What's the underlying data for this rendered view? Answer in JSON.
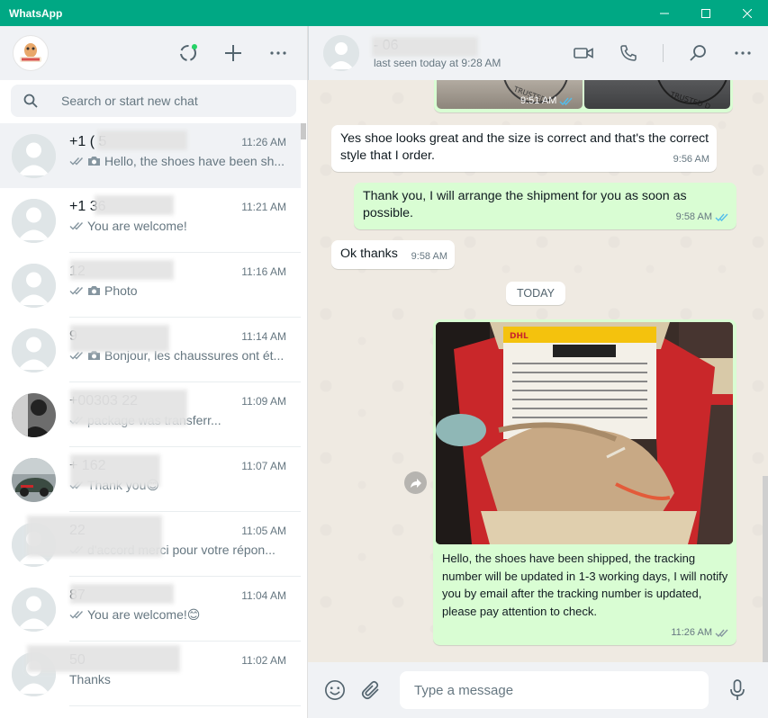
{
  "window": {
    "title": "WhatsApp"
  },
  "sidebar": {
    "search_placeholder": "Search or start new chat",
    "chats": [
      {
        "name": "+1 (           5",
        "time": "11:26 AM",
        "ticks": "read",
        "photo": true,
        "preview": "Hello, the shoes have been sh...",
        "active": true,
        "avatar": "default"
      },
      {
        "name": "+1              36",
        "time": "11:21 AM",
        "ticks": "read",
        "photo": false,
        "preview": "You are welcome!",
        "active": false,
        "avatar": "default"
      },
      {
        "name": "                12",
        "time": "11:16 AM",
        "ticks": "read",
        "photo": true,
        "preview": "Photo",
        "active": false,
        "avatar": "default"
      },
      {
        "name": "                9",
        "time": "11:14 AM",
        "ticks": "read",
        "photo": true,
        "preview": "Bonjour, les chaussures ont ét...",
        "active": false,
        "avatar": "default"
      },
      {
        "name": "+00303          22",
        "time": "11:09 AM",
        "ticks": "read",
        "photo": false,
        "preview": "package was transferr...",
        "active": false,
        "avatar": "photo-dark"
      },
      {
        "name": "+              162",
        "time": "11:07 AM",
        "ticks": "read",
        "photo": false,
        "preview": "Thank you😊",
        "active": false,
        "avatar": "photo-car"
      },
      {
        "name": "                22",
        "time": "11:05 AM",
        "ticks": "read",
        "photo": false,
        "preview": "d'accord merci pour votre répon...",
        "active": false,
        "avatar": "default"
      },
      {
        "name": "                87",
        "time": "11:04 AM",
        "ticks": "read",
        "photo": false,
        "preview": "You are welcome!😊",
        "active": false,
        "avatar": "default"
      },
      {
        "name": "                50",
        "time": "11:02 AM",
        "ticks": "none",
        "photo": false,
        "preview": "Thanks",
        "active": false,
        "avatar": "default"
      }
    ]
  },
  "conversation": {
    "contact_name": "-              06",
    "status": "last seen today at 9:28 AM",
    "messages": [
      {
        "dir": "out",
        "type": "image-pair",
        "time": "9:51 AM"
      },
      {
        "dir": "in",
        "text": "Yes shoe looks great and the size is correct and that's the correct style that I order.",
        "time": "9:56 AM"
      },
      {
        "dir": "out",
        "text": "Thank you, I will arrange the shipment for you as soon as possible.",
        "time": "9:58 AM"
      },
      {
        "dir": "in",
        "text": "Ok thanks",
        "time": "9:58 AM"
      },
      {
        "dir": "out",
        "type": "image",
        "caption": "Hello, the shoes have been shipped, the tracking number will be updated in 1-3 working days, I will notify you by email after the tracking number is updated, please pay attention to check.",
        "time": "11:26 AM"
      }
    ],
    "date_divider": "TODAY",
    "composer_placeholder": "Type a message"
  },
  "colors": {
    "brand": "#00a884",
    "bubble_out": "#d9fdd3",
    "bubble_in": "#ffffff",
    "read_tick": "#53bdeb"
  }
}
